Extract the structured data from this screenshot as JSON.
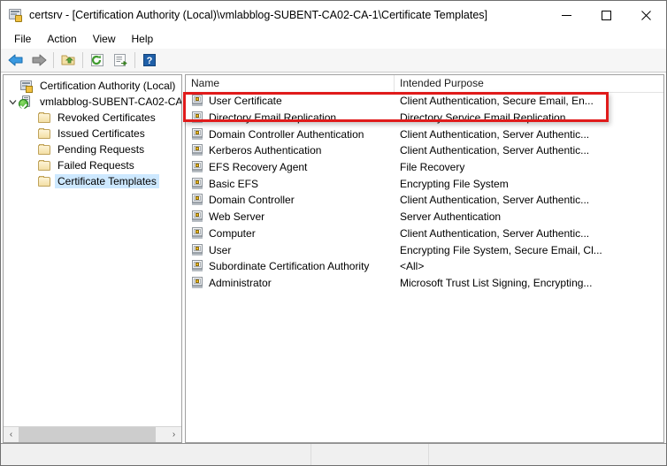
{
  "window": {
    "title": "certsrv - [Certification Authority (Local)\\vmlabblog-SUBENT-CA02-CA-1\\Certificate Templates]",
    "app_icon": "certification-authority-icon",
    "minimize_label": "Minimize",
    "maximize_label": "Maximize",
    "close_label": "Close"
  },
  "menu": {
    "items": [
      {
        "label": "File"
      },
      {
        "label": "Action"
      },
      {
        "label": "View"
      },
      {
        "label": "Help"
      }
    ]
  },
  "toolbar": {
    "buttons": [
      {
        "name": "back-icon",
        "label": "Back"
      },
      {
        "name": "forward-icon",
        "label": "Forward"
      },
      {
        "name": "up-folder-icon",
        "label": "Up One Level"
      },
      {
        "name": "refresh-icon",
        "label": "Refresh"
      },
      {
        "name": "export-list-icon",
        "label": "Export List"
      },
      {
        "name": "help-icon",
        "label": "Help"
      }
    ]
  },
  "tree": {
    "items": [
      {
        "label": "Certification Authority (Local)",
        "icon": "ca-root-icon",
        "indent": 0,
        "expander": "",
        "selected": false
      },
      {
        "label": "vmlabblog-SUBENT-CA02-CA",
        "icon": "ca-server-icon",
        "indent": 1,
        "expander": "v",
        "selected": false
      },
      {
        "label": "Revoked Certificates",
        "icon": "folder-icon",
        "indent": 2,
        "expander": "",
        "selected": false
      },
      {
        "label": "Issued Certificates",
        "icon": "folder-icon",
        "indent": 2,
        "expander": "",
        "selected": false
      },
      {
        "label": "Pending Requests",
        "icon": "folder-icon",
        "indent": 2,
        "expander": "",
        "selected": false
      },
      {
        "label": "Failed Requests",
        "icon": "folder-icon",
        "indent": 2,
        "expander": "",
        "selected": false
      },
      {
        "label": "Certificate Templates",
        "icon": "folder-icon",
        "indent": 2,
        "expander": "",
        "selected": true
      }
    ],
    "scroll_left_label": "‹",
    "scroll_right_label": "›"
  },
  "list": {
    "columns": [
      {
        "label": "Name"
      },
      {
        "label": "Intended Purpose"
      }
    ],
    "rows": [
      {
        "name": "User Certificate",
        "purpose": "Client Authentication, Secure Email, En...",
        "icon": "certificate-template-icon"
      },
      {
        "name": "Directory Email Replication",
        "purpose": "Directory Service Email Replication",
        "icon": "certificate-template-icon"
      },
      {
        "name": "Domain Controller Authentication",
        "purpose": "Client Authentication, Server Authentic...",
        "icon": "certificate-template-icon"
      },
      {
        "name": "Kerberos Authentication",
        "purpose": "Client Authentication, Server Authentic...",
        "icon": "certificate-template-icon"
      },
      {
        "name": "EFS Recovery Agent",
        "purpose": "File Recovery",
        "icon": "certificate-template-icon"
      },
      {
        "name": "Basic EFS",
        "purpose": "Encrypting File System",
        "icon": "certificate-template-icon"
      },
      {
        "name": "Domain Controller",
        "purpose": "Client Authentication, Server Authentic...",
        "icon": "certificate-template-icon"
      },
      {
        "name": "Web Server",
        "purpose": "Server Authentication",
        "icon": "certificate-template-icon"
      },
      {
        "name": "Computer",
        "purpose": "Client Authentication, Server Authentic...",
        "icon": "certificate-template-icon"
      },
      {
        "name": "User",
        "purpose": "Encrypting File System, Secure Email, Cl...",
        "icon": "certificate-template-icon"
      },
      {
        "name": "Subordinate Certification Authority",
        "purpose": "<All>",
        "icon": "certificate-template-icon"
      },
      {
        "name": "Administrator",
        "purpose": "Microsoft Trust List Signing, Encrypting...",
        "icon": "certificate-template-icon"
      }
    ]
  },
  "annotation": {
    "highlight_color": "#e01b1b",
    "target_row": "User Certificate"
  },
  "statusbar": {
    "cells": [
      "",
      "",
      ""
    ]
  }
}
